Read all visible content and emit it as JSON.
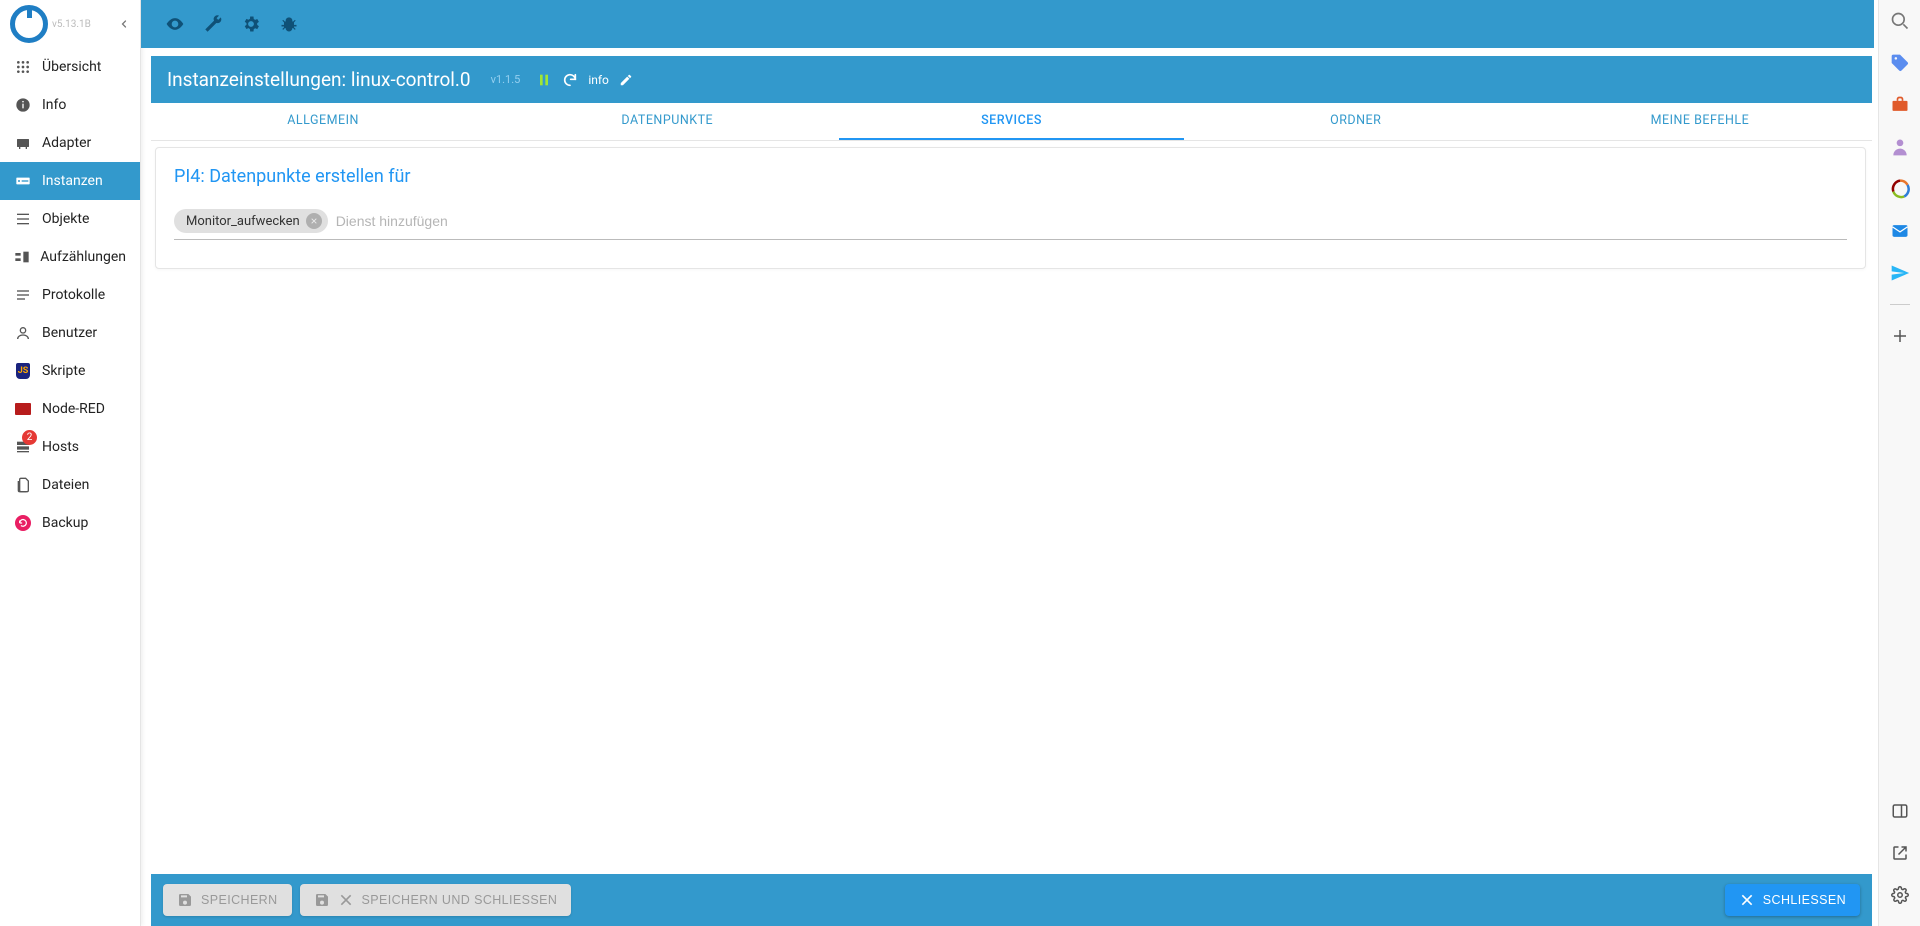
{
  "app": {
    "version": "v5.13.1B"
  },
  "sidebar": {
    "items": [
      {
        "id": "overview",
        "label": "Übersicht",
        "icon": "grid-icon"
      },
      {
        "id": "info",
        "label": "Info",
        "icon": "info-icon"
      },
      {
        "id": "adapter",
        "label": "Adapter",
        "icon": "adapter-icon"
      },
      {
        "id": "instances",
        "label": "Instanzen",
        "icon": "instances-icon",
        "active": true
      },
      {
        "id": "objects",
        "label": "Objekte",
        "icon": "list-icon"
      },
      {
        "id": "enums",
        "label": "Aufzählungen",
        "icon": "enums-icon"
      },
      {
        "id": "logs",
        "label": "Protokolle",
        "icon": "lines-icon"
      },
      {
        "id": "users",
        "label": "Benutzer",
        "icon": "user-icon"
      },
      {
        "id": "scripts",
        "label": "Skripte",
        "icon": "shield-icon"
      },
      {
        "id": "nodered",
        "label": "Node-RED",
        "icon": "nodered-icon"
      },
      {
        "id": "hosts",
        "label": "Hosts",
        "icon": "hosts-icon",
        "badge": "2"
      },
      {
        "id": "files",
        "label": "Dateien",
        "icon": "files-icon"
      },
      {
        "id": "backup",
        "label": "Backup",
        "icon": "backup-icon"
      }
    ]
  },
  "instanceBar": {
    "title_prefix": "Instanzeinstellungen: ",
    "instance": "linux-control.0",
    "version": "v1.1.5",
    "info_label": "info"
  },
  "tabs": [
    {
      "id": "allgemein",
      "label": "ALLGEMEIN"
    },
    {
      "id": "datenpunkte",
      "label": "DATENPUNKTE"
    },
    {
      "id": "services",
      "label": "SERVICES",
      "active": true
    },
    {
      "id": "ordner",
      "label": "ORDNER"
    },
    {
      "id": "meinebefehle",
      "label": "MEINE BEFEHLE"
    }
  ],
  "panel": {
    "title": "PI4: Datenpunkte erstellen für",
    "chips": [
      {
        "label": "Monitor_aufwecken"
      }
    ],
    "input_placeholder": "Dienst hinzufügen"
  },
  "bottomBar": {
    "save": "SPEICHERN",
    "saveClose": "SPEICHERN UND SCHLIESSEN",
    "close": "SCHLIESSEN"
  }
}
